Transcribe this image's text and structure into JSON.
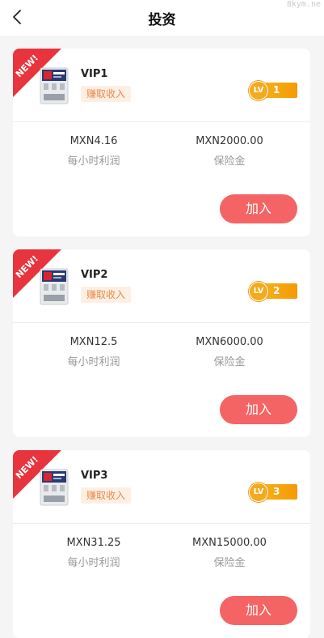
{
  "header": {
    "title": "投资",
    "watermark": "8kym.ne"
  },
  "cards": [
    {
      "ribbon": "NEW!",
      "name": "VIP1",
      "tag": "赚取收入",
      "lv_label": "LV",
      "level": "1",
      "profit_value": "MXN4.16",
      "profit_label": "每小时利润",
      "deposit_value": "MXN2000.00",
      "deposit_label": "保险金",
      "join_label": "加入"
    },
    {
      "ribbon": "NEW!",
      "name": "VIP2",
      "tag": "赚取收入",
      "lv_label": "LV",
      "level": "2",
      "profit_value": "MXN12.5",
      "profit_label": "每小时利润",
      "deposit_value": "MXN6000.00",
      "deposit_label": "保险金",
      "join_label": "加入"
    },
    {
      "ribbon": "NEW!",
      "name": "VIP3",
      "tag": "赚取收入",
      "lv_label": "LV",
      "level": "3",
      "profit_value": "MXN31.25",
      "profit_label": "每小时利润",
      "deposit_value": "MXN15000.00",
      "deposit_label": "保险金",
      "join_label": "加入"
    }
  ],
  "colors": {
    "accent_button": "#f56464",
    "tag_bg": "#fdefe3",
    "tag_text": "#ec8a4a",
    "lv_gold": "#f5a30f",
    "ribbon_red": "#e8343d"
  }
}
